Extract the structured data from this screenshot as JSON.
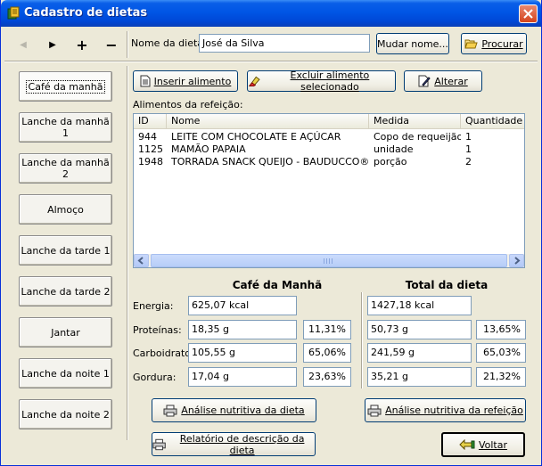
{
  "window": {
    "title": "Cadastro de dietas"
  },
  "toolbar": {
    "nav_prev": "◀",
    "nav_next": "▶",
    "add": "+",
    "remove": "−",
    "diet_name_label": "Nome da dieta:",
    "diet_name_value": "José da Silva",
    "rename_label": "Mudar nome...",
    "search_label": "Procurar"
  },
  "meals": [
    {
      "label": "Café da manhã",
      "active": true
    },
    {
      "label": "Lanche da manhã 1"
    },
    {
      "label": "Lanche da manhã 2"
    },
    {
      "label": "Almoço"
    },
    {
      "label": "Lanche da tarde 1"
    },
    {
      "label": "Lanche da tarde 2"
    },
    {
      "label": "Jantar"
    },
    {
      "label": "Lanche da noite 1"
    },
    {
      "label": "Lanche da noite 2"
    }
  ],
  "food_actions": {
    "insert_label": "Inserir alimento",
    "delete_label": "Excluir alimento selecionado",
    "edit_label": "Alterar"
  },
  "foods": {
    "caption": "Alimentos da refeição:",
    "columns": [
      "ID",
      "Nome",
      "Medida",
      "Quantidade"
    ],
    "rows": [
      {
        "id": "944",
        "name": "LEITE COM CHOCOLATE E AÇÚCAR",
        "measure": "Copo de requeijão",
        "qty": "1"
      },
      {
        "id": "1125",
        "name": "MAMÃO PAPAIA",
        "measure": "unidade",
        "qty": "1"
      },
      {
        "id": "1948",
        "name": "TORRADA SNACK QUEIJO - BAUDUCCO®",
        "measure": "porção",
        "qty": "2"
      }
    ]
  },
  "nutrition": {
    "meal_title": "Café da Manhã",
    "total_title": "Total da dieta",
    "labels": {
      "energy": "Energia:",
      "protein": "Proteínas:",
      "carbs": "Carboidratos:",
      "fat": "Gordura:"
    },
    "meal": {
      "energy": "625,07 kcal",
      "protein": "18,35 g",
      "protein_pct": "11,31%",
      "carbs": "105,55 g",
      "carbs_pct": "65,06%",
      "fat": "17,04 g",
      "fat_pct": "23,63%"
    },
    "total": {
      "energy": "1427,18 kcal",
      "protein": "50,73 g",
      "protein_pct": "13,65%",
      "carbs": "241,59 g",
      "carbs_pct": "65,03%",
      "fat": "35,21 g",
      "fat_pct": "21,32%"
    }
  },
  "footer": {
    "diet_analysis_label": "Análise nutritiva da dieta",
    "meal_analysis_label": "Análise nutritiva da refeição",
    "report_label": "Relatório de descrição da dieta",
    "back_label": "Voltar"
  }
}
